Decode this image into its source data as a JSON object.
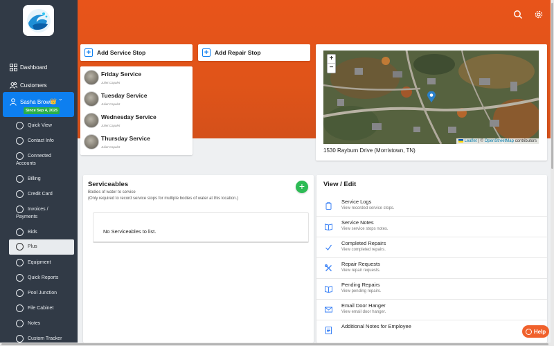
{
  "sidebar": {
    "nav": [
      {
        "label": "Dashboard",
        "icon": "dashboard-icon"
      },
      {
        "label": "Customers",
        "icon": "customers-icon"
      }
    ],
    "user": {
      "name": "Sasha Brown",
      "since": "Since Sep 4, 2025",
      "crown": "👑",
      "chevron": "⌄"
    },
    "sub_items": [
      {
        "label": "Quick View"
      },
      {
        "label": "Contact Info"
      },
      {
        "label": "Connected Accounts"
      },
      {
        "label": "Billing"
      },
      {
        "label": "Credit Card"
      },
      {
        "label": "Invoices / Payments"
      },
      {
        "label": "Bids"
      },
      {
        "label": "Plus",
        "active": true
      },
      {
        "label": "Equipment"
      },
      {
        "label": "Quick Reports"
      },
      {
        "label": "Pool Junction"
      },
      {
        "label": "File Cabinet"
      },
      {
        "label": "Notes"
      },
      {
        "label": "Custom Tracker"
      }
    ]
  },
  "actions": {
    "add_service_stop": "Add Service Stop",
    "add_repair_stop": "Add Repair Stop",
    "plus": "+"
  },
  "services": [
    {
      "title": "Friday Service",
      "tech": "Juliet Capulet"
    },
    {
      "title": "Tuesday Service",
      "tech": "Juliet Capulet"
    },
    {
      "title": "Wednesday Service",
      "tech": "Juliet Capulet"
    },
    {
      "title": "Thursday Service",
      "tech": "Juliet Capulet"
    }
  ],
  "map": {
    "zoom_in": "+",
    "zoom_out": "−",
    "attrib_leaflet": "Leaflet",
    "attrib_sep": " | © ",
    "attrib_osm": "OpenStreetMap",
    "attrib_tail": " contributors",
    "address": "1530 Rayburn Drive (Morristown, TN)"
  },
  "serviceables": {
    "title": "Serviceables",
    "hint1": "Bodies of water to service",
    "hint2": "(Only required to record service stops for multiple bodies of water at this location.)",
    "empty": "No Serviceables to list.",
    "add": "+"
  },
  "view_edit": {
    "title": "View / Edit",
    "items": [
      {
        "title": "Service Logs",
        "desc": "View recorded service stops.",
        "icon": "clipboard-icon"
      },
      {
        "title": "Service Notes",
        "desc": "View service stops notes.",
        "icon": "book-icon"
      },
      {
        "title": "Completed Repairs",
        "desc": "View completed repairs.",
        "icon": "check-icon"
      },
      {
        "title": "Repair Requests",
        "desc": "View repair requests.",
        "icon": "tools-icon"
      },
      {
        "title": "Pending Repairs",
        "desc": "View pending repairs.",
        "icon": "book-icon"
      },
      {
        "title": "Email Door Hanger",
        "desc": "View email door hanger.",
        "icon": "email-icon"
      },
      {
        "title": "Additional Notes for Employee",
        "desc": "",
        "icon": "notes-icon"
      }
    ]
  },
  "help": "Help",
  "colors": {
    "accent": "#0d7ff0",
    "header": "#e05419",
    "sidebar": "#313a46",
    "success": "#2dbb55",
    "help": "#f0612c"
  }
}
